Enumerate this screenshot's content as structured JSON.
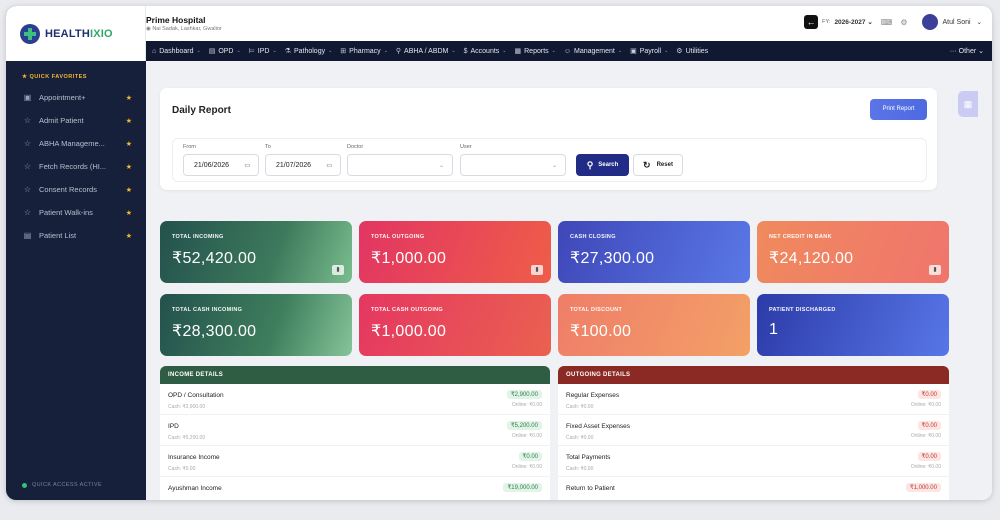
{
  "brand": {
    "name_a": "HEALTH",
    "name_b": "IXIO"
  },
  "header": {
    "hospital_name": "Prime Hospital",
    "hospital_location": "Nai Sadak, Lashkar, Gwalior",
    "fy_label": "FY:",
    "fy_value": "2026-2027",
    "user_name": "Atul Soni"
  },
  "nav": [
    {
      "label": "Dashboard",
      "icon": "⌂"
    },
    {
      "label": "OPD",
      "icon": "▤"
    },
    {
      "label": "IPD",
      "icon": "⊨"
    },
    {
      "label": "Pathology",
      "icon": "⚗"
    },
    {
      "label": "Pharmacy",
      "icon": "⊞"
    },
    {
      "label": "ABHA / ABDM",
      "icon": "⚲"
    },
    {
      "label": "Accounts",
      "icon": "$"
    },
    {
      "label": "Reports",
      "icon": "▦"
    },
    {
      "label": "Management",
      "icon": "☺"
    },
    {
      "label": "Payroll",
      "icon": "▣"
    },
    {
      "label": "Utilities",
      "icon": "⚙"
    }
  ],
  "nav_other": "··· Other",
  "sidebar": {
    "title": "★ QUICK FAVORITES",
    "items": [
      {
        "label": "Appointment+",
        "icon": "▣"
      },
      {
        "label": "Admit Patient",
        "icon": "☆"
      },
      {
        "label": "ABHA Manageme...",
        "icon": "☆"
      },
      {
        "label": "Fetch Records (HI...",
        "icon": "☆"
      },
      {
        "label": "Consent Records",
        "icon": "☆"
      },
      {
        "label": "Patient Walk-ins",
        "icon": "☆"
      },
      {
        "label": "Patient List",
        "icon": "▤"
      }
    ],
    "quick_access": "QUICK ACCESS ACTIVE"
  },
  "report": {
    "title": "Daily Report",
    "print_label": "Print Report",
    "from_label": "From",
    "from_value": "21/06/2026",
    "to_label": "To",
    "to_value": "21/07/2026",
    "doctor_label": "Doctor",
    "user_label": "User",
    "search_label": "Search",
    "reset_label": "Reset"
  },
  "stats": [
    {
      "label": "TOTAL INCOMING",
      "value": "₹52,420.00"
    },
    {
      "label": "TOTAL OUTGOING",
      "value": "₹1,000.00"
    },
    {
      "label": "CASH CLOSING",
      "value": "₹27,300.00"
    },
    {
      "label": "NET CREDIT IN BANK",
      "value": "₹24,120.00"
    },
    {
      "label": "TOTAL CASH INCOMING",
      "value": "₹28,300.00"
    },
    {
      "label": "TOTAL CASH OUTGOING",
      "value": "₹1,000.00"
    },
    {
      "label": "TOTAL DISCOUNT",
      "value": "₹100.00"
    },
    {
      "label": "PATIENT DISCHARGED",
      "value": "1"
    }
  ],
  "income": {
    "title": "INCOME DETAILS",
    "rows": [
      {
        "name": "OPD / Consultation",
        "cash": "Cash: ₹2,900.00",
        "amount": "₹2,900.00",
        "online": "Online: ₹0.00"
      },
      {
        "name": "IPD",
        "cash": "Cash: ₹5,200.00",
        "amount": "₹5,200.00",
        "online": "Online: ₹0.00"
      },
      {
        "name": "Insurance Income",
        "cash": "Cash: ₹0.00",
        "amount": "₹0.00",
        "online": "Online: ₹0.00"
      },
      {
        "name": "Ayushman Income",
        "cash": "",
        "amount": "₹19,000.00",
        "online": ""
      }
    ]
  },
  "outgoing": {
    "title": "OUTGOING DETAILS",
    "rows": [
      {
        "name": "Regular Expenses",
        "cash": "Cash: ₹0.00",
        "amount": "₹0.00",
        "online": "Online: ₹0.00"
      },
      {
        "name": "Fixed Asset Expenses",
        "cash": "Cash: ₹0.00",
        "amount": "₹0.00",
        "online": "Online: ₹0.00"
      },
      {
        "name": "Total Payments",
        "cash": "Cash: ₹0.00",
        "amount": "₹0.00",
        "online": "Online: ₹0.00"
      },
      {
        "name": "Return to Patient",
        "cash": "",
        "amount": "₹1,000.00",
        "online": ""
      }
    ]
  }
}
